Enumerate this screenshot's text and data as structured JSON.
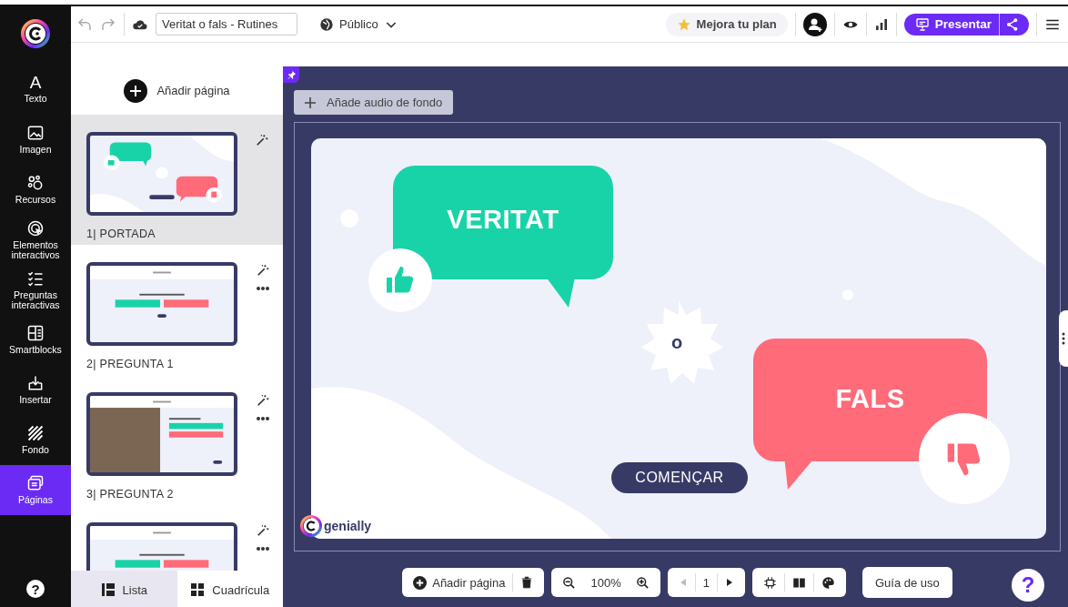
{
  "toolbar": {
    "document_title": "Veritat o fals - Rutines",
    "visibility": "Público",
    "upgrade": "Mejora tu plan",
    "present": "Presentar"
  },
  "sidebar": {
    "items": [
      {
        "kind": "text",
        "glyph": "A",
        "label": "Texto",
        "selected": false
      },
      {
        "kind": "image",
        "label": "Imagen",
        "selected": false
      },
      {
        "kind": "resources",
        "label": "Recursos",
        "selected": false
      },
      {
        "kind": "interactive",
        "label": "Elementos interactivos",
        "selected": false
      },
      {
        "kind": "questions",
        "label": "Preguntas interactivas",
        "selected": false
      },
      {
        "kind": "smartblocks",
        "label": "Smartblocks",
        "selected": false
      },
      {
        "kind": "insert",
        "label": "Insertar",
        "selected": false
      },
      {
        "kind": "background",
        "label": "Fondo",
        "selected": false
      },
      {
        "kind": "pages",
        "label": "Páginas",
        "selected": true
      }
    ],
    "help": "?"
  },
  "pages_panel": {
    "add_page": "Añadir página",
    "pages": [
      {
        "kind": "cover",
        "label": "1| PORTADA",
        "selected": true
      },
      {
        "kind": "question",
        "label": "2| PREGUNTA 1",
        "selected": false
      },
      {
        "kind": "photo_question",
        "label": "3| PREGUNTA 2",
        "selected": false
      },
      {
        "kind": "question",
        "selected": false
      }
    ],
    "views": [
      {
        "kind": "list",
        "label": "Lista",
        "selected": true
      },
      {
        "kind": "grid",
        "label": "Cuadrícula",
        "selected": false
      }
    ]
  },
  "canvas": {
    "audio_button": "Añade audio de fondo",
    "slide": {
      "true_label": "VERITAT",
      "false_label": "FALS",
      "middle": "o",
      "start_button": "COMENÇAR",
      "brand": "genially"
    },
    "bottom_toolbar": {
      "add_page": "Añadir página",
      "zoom": "100%",
      "page": "1",
      "guide": "Guía de uso"
    },
    "help": "?"
  }
}
